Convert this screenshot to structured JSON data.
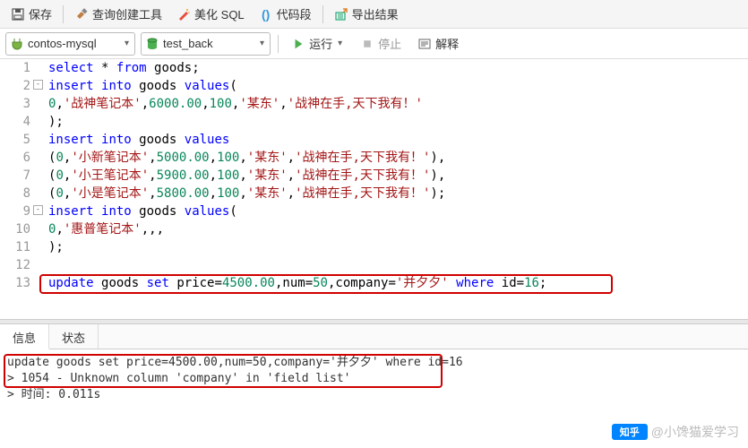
{
  "toolbar": {
    "save": "保存",
    "queryTool": "查询创建工具",
    "beautify": "美化 SQL",
    "snippet": "代码段",
    "export": "导出结果"
  },
  "conn": {
    "server": "contos-mysql",
    "db": "test_back",
    "run": "运行",
    "stop": "停止",
    "explain": "解释"
  },
  "code": [
    {
      "n": "1",
      "fold": "",
      "t": [
        [
          "kw",
          "select"
        ],
        [
          "sp",
          " "
        ],
        [
          "star",
          "*"
        ],
        [
          "sp",
          " "
        ],
        [
          "kw",
          "from"
        ],
        [
          "sp",
          " "
        ],
        [
          "ident",
          "goods"
        ],
        [
          "punc",
          ";"
        ]
      ]
    },
    {
      "n": "2",
      "fold": "-",
      "t": [
        [
          "kw",
          "insert"
        ],
        [
          "sp",
          " "
        ],
        [
          "kw",
          "into"
        ],
        [
          "sp",
          " "
        ],
        [
          "ident",
          "goods"
        ],
        [
          "sp",
          " "
        ],
        [
          "kw",
          "values"
        ],
        [
          "punc",
          "("
        ]
      ]
    },
    {
      "n": "3",
      "fold": "",
      "t": [
        [
          "num",
          "0"
        ],
        [
          "punc",
          ","
        ],
        [
          "str",
          "'战神笔记本'"
        ],
        [
          "punc",
          ","
        ],
        [
          "num",
          "6000.00"
        ],
        [
          "punc",
          ","
        ],
        [
          "num",
          "100"
        ],
        [
          "punc",
          ","
        ],
        [
          "str",
          "'某东'"
        ],
        [
          "punc",
          ","
        ],
        [
          "str",
          "'战神在手,天下我有！'"
        ]
      ]
    },
    {
      "n": "4",
      "fold": "",
      "t": [
        [
          "punc",
          ");"
        ]
      ]
    },
    {
      "n": "5",
      "fold": "",
      "t": [
        [
          "kw",
          "insert"
        ],
        [
          "sp",
          " "
        ],
        [
          "kw",
          "into"
        ],
        [
          "sp",
          " "
        ],
        [
          "ident",
          "goods"
        ],
        [
          "sp",
          " "
        ],
        [
          "kw",
          "values"
        ]
      ]
    },
    {
      "n": "6",
      "fold": "",
      "t": [
        [
          "punc",
          "("
        ],
        [
          "num",
          "0"
        ],
        [
          "punc",
          ","
        ],
        [
          "str",
          "'小新笔记本'"
        ],
        [
          "punc",
          ","
        ],
        [
          "num",
          "5000.00"
        ],
        [
          "punc",
          ","
        ],
        [
          "num",
          "100"
        ],
        [
          "punc",
          ","
        ],
        [
          "str",
          "'某东'"
        ],
        [
          "punc",
          ","
        ],
        [
          "str",
          "'战神在手,天下我有！'"
        ],
        [
          "punc",
          "),"
        ]
      ]
    },
    {
      "n": "7",
      "fold": "",
      "t": [
        [
          "punc",
          "("
        ],
        [
          "num",
          "0"
        ],
        [
          "punc",
          ","
        ],
        [
          "str",
          "'小王笔记本'"
        ],
        [
          "punc",
          ","
        ],
        [
          "num",
          "5900.00"
        ],
        [
          "punc",
          ","
        ],
        [
          "num",
          "100"
        ],
        [
          "punc",
          ","
        ],
        [
          "str",
          "'某东'"
        ],
        [
          "punc",
          ","
        ],
        [
          "str",
          "'战神在手,天下我有！'"
        ],
        [
          "punc",
          "),"
        ]
      ]
    },
    {
      "n": "8",
      "fold": "",
      "t": [
        [
          "punc",
          "("
        ],
        [
          "num",
          "0"
        ],
        [
          "punc",
          ","
        ],
        [
          "str",
          "'小是笔记本'"
        ],
        [
          "punc",
          ","
        ],
        [
          "num",
          "5800.00"
        ],
        [
          "punc",
          ","
        ],
        [
          "num",
          "100"
        ],
        [
          "punc",
          ","
        ],
        [
          "str",
          "'某东'"
        ],
        [
          "punc",
          ","
        ],
        [
          "str",
          "'战神在手,天下我有！'"
        ],
        [
          "punc",
          ");"
        ]
      ]
    },
    {
      "n": "9",
      "fold": "-",
      "t": [
        [
          "kw",
          "insert"
        ],
        [
          "sp",
          " "
        ],
        [
          "kw",
          "into"
        ],
        [
          "sp",
          " "
        ],
        [
          "ident",
          "goods"
        ],
        [
          "sp",
          " "
        ],
        [
          "kw",
          "values"
        ],
        [
          "punc",
          "("
        ]
      ]
    },
    {
      "n": "10",
      "fold": "",
      "t": [
        [
          "num",
          "0"
        ],
        [
          "punc",
          ","
        ],
        [
          "str",
          "'惠普笔记本'"
        ],
        [
          "punc",
          ",,,"
        ]
      ]
    },
    {
      "n": "11",
      "fold": "",
      "t": [
        [
          "punc",
          ");"
        ]
      ]
    },
    {
      "n": "12",
      "fold": "",
      "t": []
    },
    {
      "n": "13",
      "fold": "",
      "t": [
        [
          "kw",
          "update"
        ],
        [
          "sp",
          " "
        ],
        [
          "ident",
          "goods"
        ],
        [
          "sp",
          " "
        ],
        [
          "kw",
          "set"
        ],
        [
          "sp",
          " "
        ],
        [
          "ident",
          "price"
        ],
        [
          "punc",
          "="
        ],
        [
          "num",
          "4500.00"
        ],
        [
          "punc",
          ","
        ],
        [
          "ident",
          "num"
        ],
        [
          "punc",
          "="
        ],
        [
          "num",
          "50"
        ],
        [
          "punc",
          ","
        ],
        [
          "ident",
          "company"
        ],
        [
          "punc",
          "="
        ],
        [
          "str",
          "'并夕夕'"
        ],
        [
          "sp",
          " "
        ],
        [
          "kw",
          "where"
        ],
        [
          "sp",
          " "
        ],
        [
          "ident",
          "id"
        ],
        [
          "punc",
          "="
        ],
        [
          "num",
          "16"
        ],
        [
          "punc",
          ";"
        ]
      ]
    }
  ],
  "tabs": {
    "info": "信息",
    "status": "状态"
  },
  "output": {
    "l1": "update goods set price=4500.00,num=50,company='并夕夕' where id=16",
    "l2": "> 1054 - Unknown column 'company' in 'field list'",
    "l3": "> 时间: 0.011s"
  },
  "watermark": "@小馋猫爱学习"
}
